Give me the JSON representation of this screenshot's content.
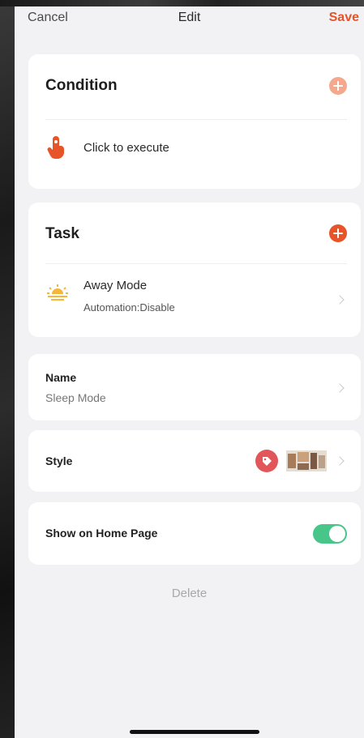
{
  "nav": {
    "cancel_label": "Cancel",
    "title": "Edit",
    "save_label": "Save"
  },
  "condition": {
    "title": "Condition",
    "item_label": "Click to execute",
    "item_icon": "tap-hand-icon",
    "add_icon": "plus-circle-icon",
    "add_color": "#f4a98e"
  },
  "task": {
    "title": "Task",
    "item_label": "Away Mode",
    "item_sub": "Automation:Disable",
    "item_icon": "sunrise-icon",
    "add_icon": "plus-circle-icon",
    "add_color": "#e8542a"
  },
  "name": {
    "label": "Name",
    "value": "Sleep Mode"
  },
  "style": {
    "label": "Style",
    "icon": "tag-icon",
    "icon_color": "#e2565a",
    "thumbnail": "room-thumbnail"
  },
  "home_page": {
    "label": "Show on Home Page",
    "enabled": true,
    "toggle_color": "#48c589"
  },
  "delete_label": "Delete",
  "colors": {
    "accent": "#e8542a",
    "background": "#f2f2f4",
    "card": "#ffffff"
  }
}
